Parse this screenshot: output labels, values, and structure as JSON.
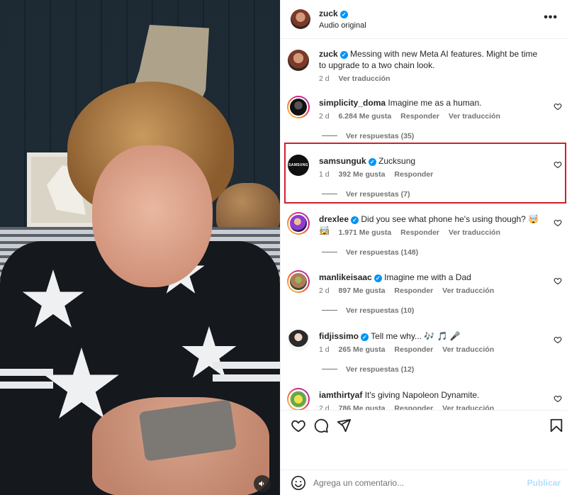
{
  "header": {
    "username": "zuck",
    "audio": "Audio original",
    "more": "•••"
  },
  "caption": {
    "username": "zuck",
    "text": "Messing with new Meta AI features. Might be time to upgrade to a two chain look.",
    "time": "2 d",
    "translate": "Ver traducción"
  },
  "comments": [
    {
      "username": "simplicity_doma",
      "verified": false,
      "text": "Imagine me as a human.",
      "time": "2 d",
      "likes": "6.284 Me gusta",
      "reply": "Responder",
      "translate": "Ver traducción",
      "replies": "Ver respuestas (35)"
    },
    {
      "username": "samsunguk",
      "verified": true,
      "text": "Zucksung",
      "time": "1 d",
      "likes": "392 Me gusta",
      "reply": "Responder",
      "translate": "",
      "replies": "Ver respuestas (7)",
      "avatar_text": "SAMSUNG"
    },
    {
      "username": "drexlee",
      "verified": true,
      "text": "Did you see what phone he's using though? 🤯 🤯",
      "time": "1 d",
      "likes": "1.971 Me gusta",
      "reply": "Responder",
      "translate": "Ver traducción",
      "replies": "Ver respuestas (148)"
    },
    {
      "username": "manlikeisaac",
      "verified": true,
      "text": "Imagine me with a Dad",
      "time": "2 d",
      "likes": "897 Me gusta",
      "reply": "Responder",
      "translate": "Ver traducción",
      "replies": "Ver respuestas (10)"
    },
    {
      "username": "fidjissimo",
      "verified": true,
      "text": "Tell me why... 🎶 🎵 🎤",
      "time": "1 d",
      "likes": "265 Me gusta",
      "reply": "Responder",
      "translate": "Ver traducción",
      "replies": "Ver respuestas (12)"
    },
    {
      "username": "iamthirtyaf",
      "verified": false,
      "text": "It's giving Napoleon Dynamite.",
      "time": "2 d",
      "likes": "786 Me gusta",
      "reply": "Responder",
      "translate": "Ver traducción",
      "replies": ""
    }
  ],
  "comment_bar": {
    "placeholder": "Agrega un comentario...",
    "publish": "Publicar"
  },
  "icons": {
    "heart": "heart-icon",
    "comment": "comment-icon",
    "share": "share-icon",
    "save": "bookmark-icon",
    "emoji": "emoji-icon",
    "audio": "speaker-icon"
  },
  "colors": {
    "verified": "#0095f6",
    "highlight": "#d11f2a",
    "muted": "#737373",
    "publish": "#b2dffc"
  }
}
